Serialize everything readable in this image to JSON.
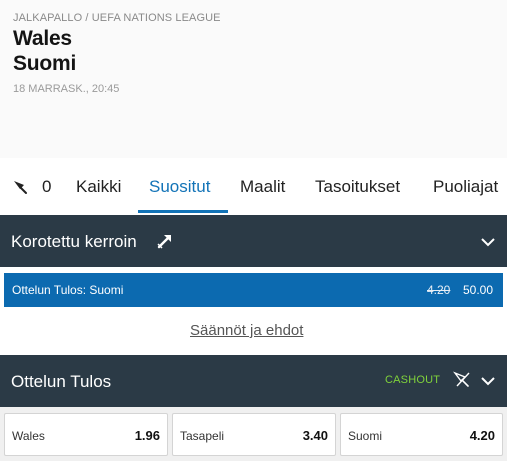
{
  "event": {
    "breadcrumb": "JALKAPALLO / UEFA NATIONS LEAGUE",
    "home_team": "Wales",
    "away_team": "Suomi",
    "start_time": "18 MARRASK., 20:45"
  },
  "tabs": {
    "pinned_count": "0",
    "items": [
      "Kaikki",
      "Suositut",
      "Maalit",
      "Tasoitukset",
      "Puoliajat"
    ],
    "active": "Suositut"
  },
  "boosted": {
    "title": "Korotettu kerroin",
    "selection": "Ottelun Tulos: Suomi",
    "old_odds": "4.20",
    "new_odds": "50.00",
    "rules_link": "Säännöt ja ehdot"
  },
  "match_result": {
    "title": "Ottelun Tulos",
    "cashout": "CASHOUT",
    "outcomes": [
      {
        "label": "Wales",
        "odds": "1.96"
      },
      {
        "label": "Tasapeli",
        "odds": "3.40"
      },
      {
        "label": "Suomi",
        "odds": "4.20"
      }
    ]
  },
  "colors": {
    "accent": "#1273b7",
    "section_bar": "#2b3a46",
    "boost_row": "#0c6ab0",
    "cashout": "#7fd13b"
  },
  "icons": [
    "pin-icon",
    "boost-arrow-icon",
    "chevron-down-icon",
    "unpin-icon"
  ]
}
